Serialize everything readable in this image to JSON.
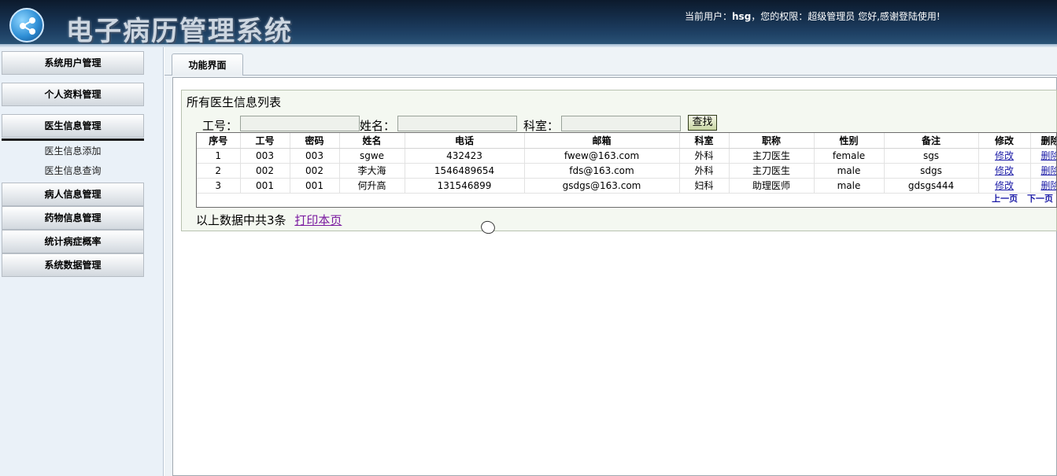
{
  "header": {
    "app_title": "电子病历管理系统",
    "user_prefix": "当前用户：",
    "user_name": "hsg",
    "role_text": "，您的权限：超级管理员  您好,感谢登陆使用!"
  },
  "sidebar": {
    "items": [
      {
        "label": "系统用户管理"
      },
      {
        "label": "个人资料管理"
      },
      {
        "label": "医生信息管理"
      },
      {
        "label": "病人信息管理"
      },
      {
        "label": "药物信息管理"
      },
      {
        "label": "统计病症概率"
      },
      {
        "label": "系统数据管理"
      }
    ],
    "sub_items": [
      {
        "label": "医生信息添加"
      },
      {
        "label": "医生信息查询"
      }
    ]
  },
  "tabs": [
    {
      "label": "功能界面"
    }
  ],
  "panel": {
    "title": "所有医生信息列表",
    "search": {
      "id_label": "工号：",
      "name_label": "姓名：",
      "dept_label": "科室：",
      "id_value": "",
      "name_value": "",
      "dept_value": "",
      "button": "查找"
    },
    "table": {
      "headers": [
        "序号",
        "工号",
        "密码",
        "姓名",
        "电话",
        "邮箱",
        "科室",
        "职称",
        "性别",
        "备注",
        "修改",
        "删除"
      ],
      "rows": [
        [
          "1",
          "003",
          "003",
          "sgwe",
          "432423",
          "fwew@163.com",
          "外科",
          "主刀医生",
          "female",
          "sgs",
          "修改",
          "删除"
        ],
        [
          "2",
          "002",
          "002",
          "李大海",
          "1546489654",
          "fds@163.com",
          "外科",
          "主刀医生",
          "male",
          "sdgs",
          "修改",
          "删除"
        ],
        [
          "3",
          "001",
          "001",
          "何升高",
          "131546899",
          "gsdgs@163.com",
          "妇科",
          "助理医师",
          "male",
          "gdsgs444",
          "修改",
          "删除"
        ]
      ]
    },
    "pager": {
      "prev": "上一页",
      "next": "下一页"
    },
    "summary": "以上数据中共3条",
    "print": "打印本页"
  }
}
